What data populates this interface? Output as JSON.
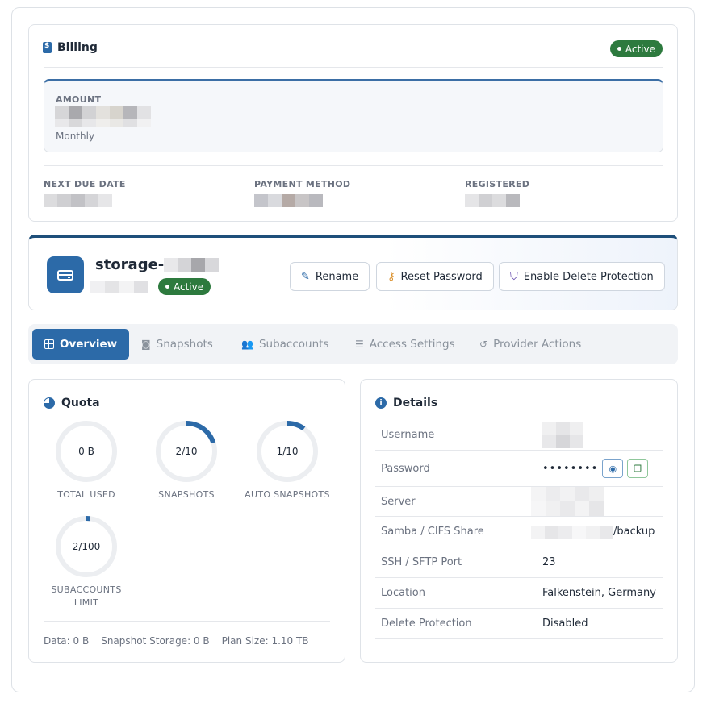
{
  "billing": {
    "title": "Billing",
    "status": "Active",
    "amount_label": "AMOUNT",
    "amount_period": "Monthly",
    "next_due_label": "NEXT DUE DATE",
    "payment_method_label": "PAYMENT METHOD",
    "registered_label": "REGISTERED"
  },
  "server": {
    "name_prefix": "storage-",
    "status": "Active",
    "actions": {
      "rename": "Rename",
      "reset_password": "Reset Password",
      "delete_protection": "Enable Delete Protection"
    }
  },
  "tabs": [
    {
      "label": "Overview",
      "icon": "grid-icon"
    },
    {
      "label": "Snapshots",
      "icon": "camera-icon"
    },
    {
      "label": "Subaccounts",
      "icon": "users-icon"
    },
    {
      "label": "Access Settings",
      "icon": "sliders-icon"
    },
    {
      "label": "Provider Actions",
      "icon": "history-icon"
    }
  ],
  "quota": {
    "title": "Quota",
    "gauges": [
      {
        "value": "0 B",
        "label": "TOTAL USED",
        "fraction": 0
      },
      {
        "value": "2/10",
        "label": "SNAPSHOTS",
        "fraction": 0.2
      },
      {
        "value": "1/10",
        "label": "AUTO SNAPSHOTS",
        "fraction": 0.1
      },
      {
        "value": "2/100",
        "label": "SUBACCOUNTS LIMIT",
        "fraction": 0.02
      }
    ],
    "footer": {
      "data": "Data: 0 B",
      "snapshot_storage": "Snapshot Storage: 0 B",
      "plan_size": "Plan Size: 1.10 TB"
    }
  },
  "details": {
    "title": "Details",
    "rows": {
      "username": {
        "key": "Username"
      },
      "password": {
        "key": "Password",
        "value": "••••••••"
      },
      "server": {
        "key": "Server"
      },
      "samba": {
        "key": "Samba / CIFS Share",
        "value": "/backup"
      },
      "ssh_port": {
        "key": "SSH / SFTP Port",
        "value": "23"
      },
      "location": {
        "key": "Location",
        "value": "Falkenstein, Germany"
      },
      "delete_protection": {
        "key": "Delete Protection",
        "value": "Disabled"
      }
    }
  },
  "colors": {
    "primary": "#2c6aa8",
    "success": "#2d7a3e",
    "gauge_track": "#eceef1"
  }
}
